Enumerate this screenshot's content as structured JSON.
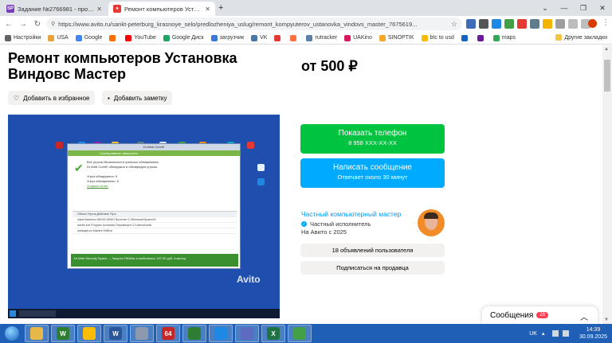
{
  "browser": {
    "tabs": [
      {
        "favicon": "SP",
        "title": "Задание №2766981 - просмотр з"
      },
      {
        "favicon": "avito",
        "title": "Ремонт компьютеров Установка"
      }
    ],
    "url": "https://www.avito.ru/sankt-peterburg_krasnoye_selo/predlozheniya_uslug/remont_kompyuterov_ustanovka_vindovs_master_7675619...",
    "profile_initial": "",
    "bookmarks": [
      {
        "label": "Настройки",
        "color": "#5f6368"
      },
      {
        "label": "USA",
        "color": "#e8a33d"
      },
      {
        "label": "Google",
        "color": "#4285f4"
      },
      {
        "label": "",
        "color": "#ff6d00"
      },
      {
        "label": "YouTube",
        "color": "#ff0000"
      },
      {
        "label": "Google Диск",
        "color": "#1fa463"
      },
      {
        "label": "загрузчик",
        "color": "#3c78d8"
      },
      {
        "label": "VK",
        "color": "#4a76a8"
      },
      {
        "label": "",
        "color": "#e53935"
      },
      {
        "label": "",
        "color": "#ff7043"
      },
      {
        "label": "rutracker",
        "color": "#5a7fa8"
      },
      {
        "label": "UAKino",
        "color": "#d81b60"
      },
      {
        "label": "SINOPTIK",
        "color": "#f9a825"
      },
      {
        "label": "btc to usd",
        "color": "#fbbc05"
      },
      {
        "label": "",
        "color": "#1565c0"
      },
      {
        "label": "",
        "color": "#6a1b9a"
      },
      {
        "label": "maps",
        "color": "#34a853"
      }
    ],
    "other_bookmarks": "Другие закладки"
  },
  "listing": {
    "title": "Ремонт компьютеров Установка Виндовс Мастер",
    "price": "от 500 ₽",
    "favorite_label": "Добавить в избранное",
    "note_label": "Добавить заметку",
    "photo_watermark": "Avito",
    "photo": {
      "dialog_title": "Dr.Web CureIt!",
      "dialog_header": "Сканирование завершено",
      "dialog_line1": "Все угрозы безопасности успешно обезврежены.",
      "dialog_line2": "Dr.Web CureIt! обнаружил и обезвредил угрозы.",
      "stat1": "Угроз обнаружено:  5",
      "stat2": "Угроз обезврежено:  5",
      "report_link": "Открыть отчет",
      "table_header": "Объект    Угроза    Действие    Путь",
      "row1": "ktank     Backdoor.WIN32.DEMO    Вылечен    C:\\Windows\\System32",
      "row2": "adobe.exe   Program.Unwanted   Перемещен   C:\\Users\\Admin",
      "row3": "packagecon   Adware.Selfbox   ",
      "banner": "Dr.Web Security Space — Защита ПК/Mac и мобильных 197,90 руб. в месяц"
    },
    "call_button": {
      "label": "Показать телефон",
      "sub": "8 958 XXX-XX-XX"
    },
    "message_button": {
      "label": "Написать сообщение",
      "sub": "Отвечает около 30 минут"
    },
    "seller": {
      "name": "Частный компьютерный мастер",
      "type": "Частный исполнитель",
      "since": "На Авито с 2025"
    },
    "listings_button": "18 объявлений пользователя",
    "subscribe_button": "Подписаться на продавца"
  },
  "messages_widget": {
    "label": "Сообщения",
    "count": "28"
  },
  "taskbar": {
    "apps": [
      {
        "name": "explorer",
        "glyph": "",
        "color": "#e6b84a",
        "active": true
      },
      {
        "name": "wincleaner",
        "glyph": "W",
        "color": "#2e7d32",
        "active": true
      },
      {
        "name": "chrome",
        "glyph": "",
        "color": "#fbbc05",
        "active": true
      },
      {
        "name": "word",
        "glyph": "W",
        "color": "#2b579a",
        "active": true
      },
      {
        "name": "tool",
        "glyph": "",
        "color": "#8d99ae",
        "active": true
      },
      {
        "name": "aida64",
        "glyph": "64",
        "color": "#c62828",
        "active": true
      },
      {
        "name": "mpc",
        "glyph": "",
        "color": "#2e7d32",
        "active": true
      },
      {
        "name": "app8",
        "glyph": "",
        "color": "#1e88e5",
        "active": true
      },
      {
        "name": "network",
        "glyph": "",
        "color": "#5c6bc0",
        "active": true
      },
      {
        "name": "excel",
        "glyph": "X",
        "color": "#217346",
        "active": true
      },
      {
        "name": "monitor",
        "glyph": "",
        "color": "#43a047",
        "active": true
      }
    ],
    "lang": "UK",
    "time": "14:39",
    "date": "30.09.2025"
  }
}
